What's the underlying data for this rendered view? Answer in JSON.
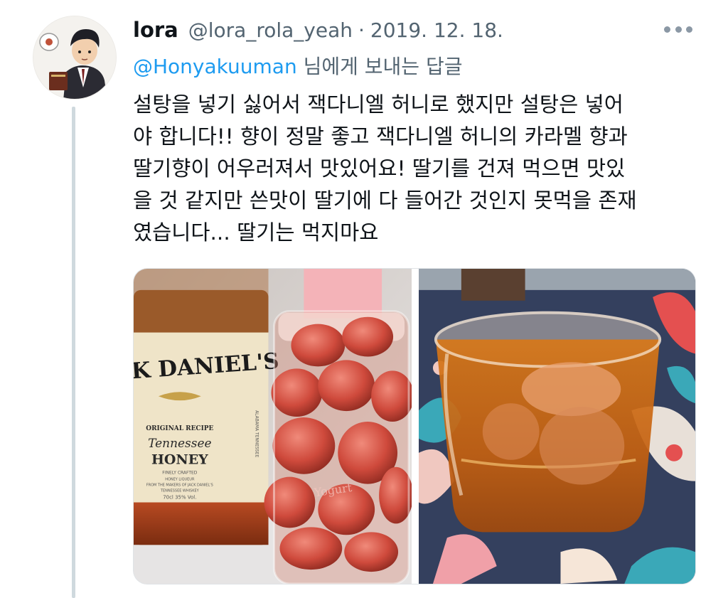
{
  "tweet": {
    "display_name": "lora",
    "handle": "@lora_rola_yeah",
    "separator": "·",
    "date": "2019. 12. 18.",
    "reply_mention": "@Honyakuuman",
    "reply_suffix": " 님에게 보내는 답글",
    "body_lines": [
      "설탕을 넣기 싫어서 잭다니엘 허니로 했지만 설탕은 넣어",
      "야 합니다!! 향이 정말 좋고 잭다니엘 허니의 카라멜 향과",
      "딸기향이 어우러져서 맛있어요! 딸기를 건져 먹으면 맛있",
      "을 것 같지만 쓴맛이 딸기에 다 들어간 것인지 못먹을 존재",
      "였습니다... 딸기는 먹지마요"
    ]
  },
  "photo_left": {
    "label_brand": "JACK DANIEL'S",
    "label_recipe": "ORIGINAL RECIPE",
    "label_line1": "Tennessee",
    "label_line2": "HONEY",
    "label_small1": "FINELY CRAFTED",
    "label_small2": "HONEY LIQUEUR",
    "label_small3": "FROM THE MAKERS OF JACK DANIEL'S",
    "label_small4": "TENNESSEE WHISKEY",
    "label_volume": "70cl 35% Vol.",
    "label_side": "ALABAMA TENNESSEE",
    "jar_text": "Yogurt"
  },
  "icons": {
    "more": "more-horizontal-icon",
    "avatar": "avatar-illustration"
  },
  "colors": {
    "link": "#1d9bf0",
    "secondary_text": "#536471",
    "thread_line": "#cfd9de"
  }
}
